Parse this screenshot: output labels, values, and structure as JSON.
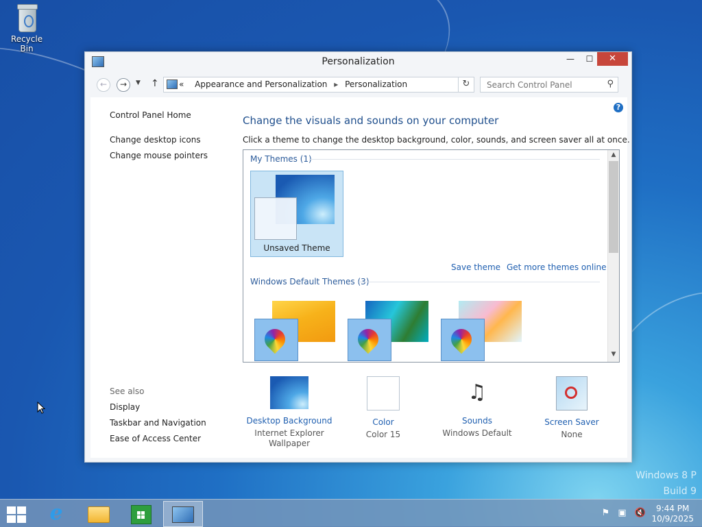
{
  "desktop": {
    "recycle_bin_label": "Recycle Bin",
    "watermark_line1": "Windows 8 P",
    "watermark_line2": "Build 9"
  },
  "window": {
    "title": "Personalization",
    "controls": {
      "minimize": "—",
      "maximize": "☐",
      "close": "✕"
    }
  },
  "navbar": {
    "breadcrumb_prefix": "«",
    "breadcrumb": [
      "Appearance and Personalization",
      "Personalization"
    ],
    "search_placeholder": "Search Control Panel"
  },
  "left_pane": {
    "home": "Control Panel Home",
    "links": [
      "Change desktop icons",
      "Change mouse pointers"
    ],
    "see_also_heading": "See also",
    "see_also": [
      "Display",
      "Taskbar and Navigation",
      "Ease of Access Center"
    ]
  },
  "main": {
    "heading": "Change the visuals and sounds on your computer",
    "subtext": "Click a theme to change the desktop background, color, sounds, and screen saver all at once.",
    "my_themes_label": "My Themes (1)",
    "unsaved_theme_label": "Unsaved Theme",
    "save_theme": "Save theme",
    "get_more_themes": "Get more themes online",
    "default_themes_label": "Windows Default Themes (3)"
  },
  "bottom_items": [
    {
      "title": "Desktop Background",
      "sub": "Internet Explorer Wallpaper"
    },
    {
      "title": "Color",
      "sub": "Color 15"
    },
    {
      "title": "Sounds",
      "sub": "Windows Default"
    },
    {
      "title": "Screen Saver",
      "sub": "None"
    }
  ],
  "taskbar": {
    "time": "9:44 PM",
    "date": "10/9/2025"
  },
  "colors": {
    "accent_link": "#1f5fb0",
    "selected_tile": "#c9e4f6",
    "close_button": "#c7463b"
  }
}
